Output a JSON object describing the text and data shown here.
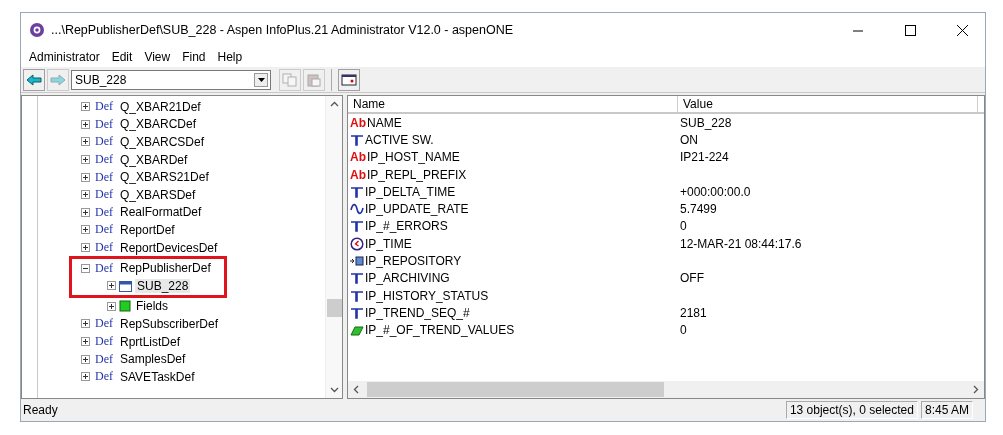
{
  "window": {
    "title": "...\\RepPublisherDef\\SUB_228 - Aspen InfoPlus.21 Administrator V12.0 - aspenONE"
  },
  "menu": [
    "Administrator",
    "Edit",
    "View",
    "Find",
    "Help"
  ],
  "toolbar": {
    "back_disabled": false,
    "forward_disabled": true,
    "location": "SUB_228",
    "copy_disabled": true,
    "paste_disabled": true
  },
  "tree": [
    {
      "badge": "Def",
      "label": "Q_XBAR21Def",
      "expanded": false
    },
    {
      "badge": "Def",
      "label": "Q_XBARCDef",
      "expanded": false
    },
    {
      "badge": "Def",
      "label": "Q_XBARCSDef",
      "expanded": false
    },
    {
      "badge": "Def",
      "label": "Q_XBARDef",
      "expanded": false
    },
    {
      "badge": "Def",
      "label": "Q_XBARS21Def",
      "expanded": false
    },
    {
      "badge": "Def",
      "label": "Q_XBARSDef",
      "expanded": false
    },
    {
      "badge": "Def",
      "label": "RealFormatDef",
      "expanded": false
    },
    {
      "badge": "Def",
      "label": "ReportDef",
      "expanded": false
    },
    {
      "badge": "Def",
      "label": "ReportDevicesDef",
      "expanded": false
    },
    {
      "badge": "Def",
      "label": "RepPublisherDef",
      "expanded": true,
      "annotated": true,
      "children": [
        {
          "kind": "record",
          "label": "SUB_228",
          "expanded": false,
          "selected": true
        },
        {
          "kind": "folder",
          "label": "Fields",
          "expanded": false,
          "selected": false
        }
      ]
    },
    {
      "badge": "Def",
      "label": "RepSubscriberDef",
      "expanded": false
    },
    {
      "badge": "Def",
      "label": "RprtListDef",
      "expanded": false
    },
    {
      "badge": "Def",
      "label": "SamplesDef",
      "expanded": false
    },
    {
      "badge": "Def",
      "label": "SAVETaskDef",
      "expanded": false
    }
  ],
  "properties": {
    "columns": [
      "Name",
      "Value"
    ],
    "rows": [
      {
        "kind": "text",
        "icon_text": "Ab",
        "name": "NAME",
        "value": "SUB_228"
      },
      {
        "kind": "discrete",
        "name": "ACTIVE SW.",
        "value": "ON"
      },
      {
        "kind": "text",
        "icon_text": "Ab",
        "name": "IP_HOST_NAME",
        "value": "IP21-224"
      },
      {
        "kind": "text",
        "icon_text": "Ab",
        "name": "IP_REPL_PREFIX"
      },
      {
        "kind": "discrete",
        "name": "IP_DELTA_TIME",
        "value": "+000:00:00.0"
      },
      {
        "kind": "analog",
        "name": "IP_UPDATE_RATE",
        "value": "5.7499"
      },
      {
        "kind": "discrete",
        "name": "IP_#_ERRORS",
        "value": "0"
      },
      {
        "kind": "time",
        "name": "IP_TIME",
        "value": "12-MAR-21 08:44:17.6"
      },
      {
        "kind": "repository",
        "name": "IP_REPOSITORY"
      },
      {
        "kind": "discrete",
        "name": "IP_ARCHIVING",
        "value": "OFF"
      },
      {
        "kind": "discrete",
        "name": "IP_HISTORY_STATUS"
      },
      {
        "kind": "discrete",
        "name": "IP_TREND_SEQ_#",
        "value": "2181"
      },
      {
        "kind": "block",
        "name": "IP_#_OF_TREND_VALUES",
        "value": "0"
      }
    ]
  },
  "status_bar": {
    "message": "Ready",
    "objects": "13 object(s), 0 selected",
    "time": "8:45 AM"
  }
}
